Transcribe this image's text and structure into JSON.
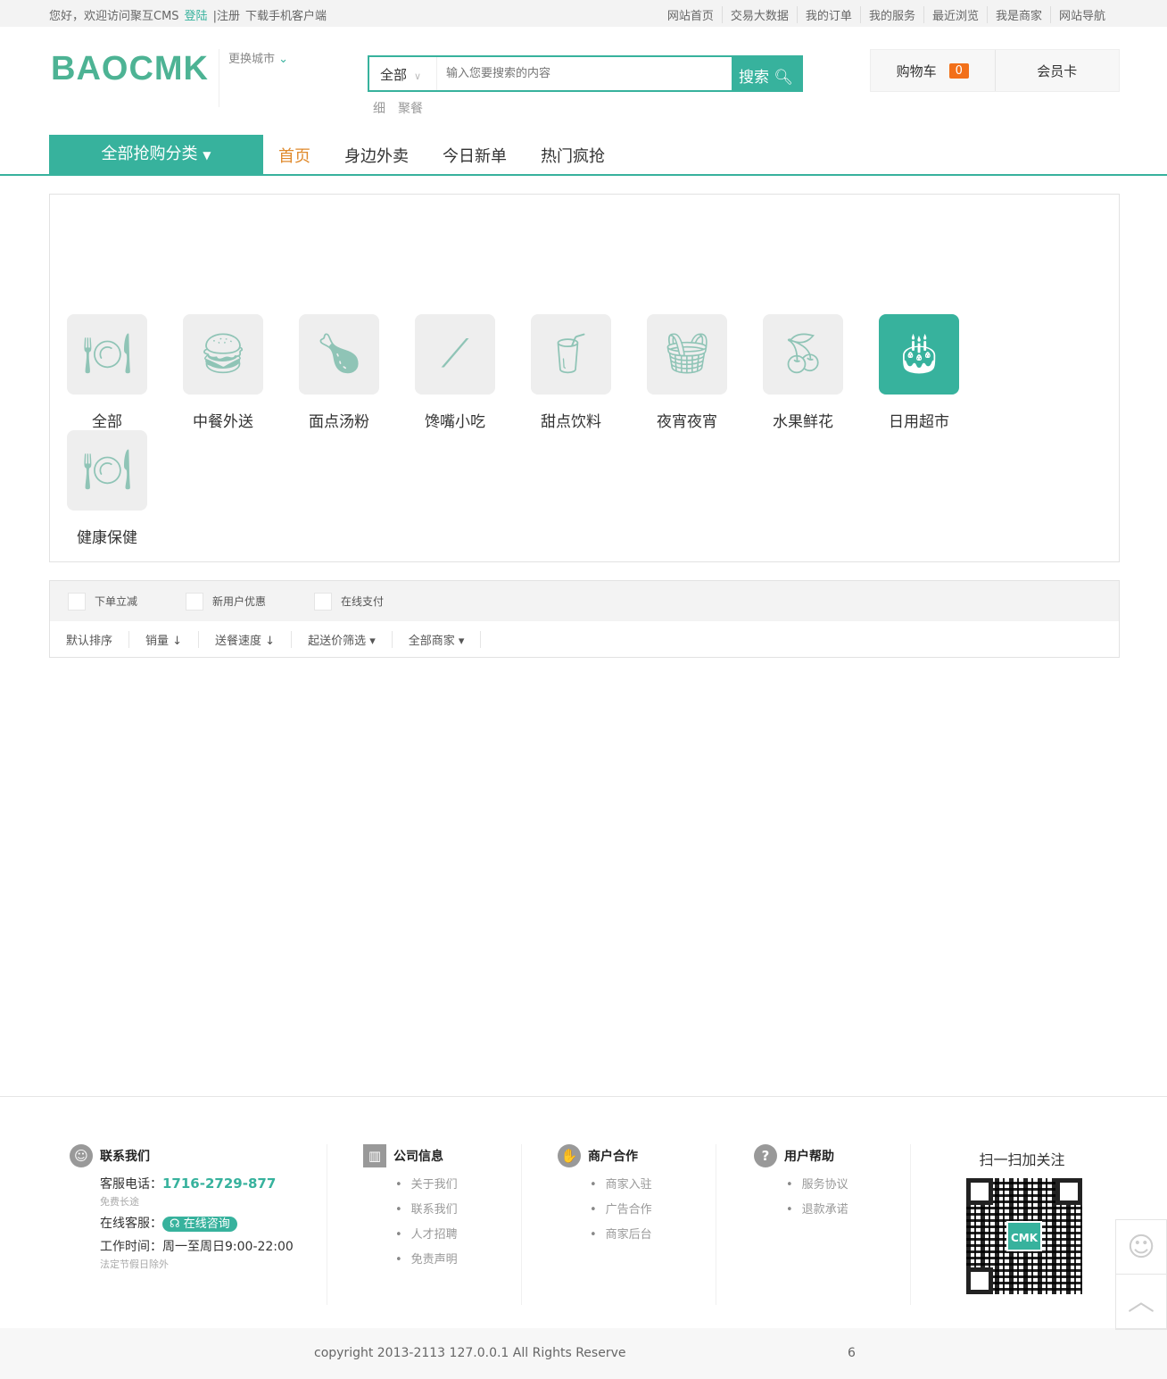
{
  "topbar": {
    "welcome": "您好，欢迎访问聚互CMS",
    "login": "登陆",
    "register": "注册",
    "download": "下载手机客户端",
    "links": [
      "网站首页",
      "交易大数据",
      "我的订单",
      "我的服务",
      "最近浏览",
      "我是商家",
      "网站导航"
    ]
  },
  "header": {
    "logo": "BAOCMK",
    "city": "更换城市",
    "search_scope": "全部",
    "search_placeholder": "输入您要搜索的内容",
    "search_button": "搜索",
    "hot_words": [
      "细",
      "聚餐"
    ],
    "cart": "购物车",
    "cart_count": "0",
    "member_card": "会员卡"
  },
  "nav": {
    "all_categories": "全部抢购分类",
    "items": [
      "首页",
      "身边外卖",
      "今日新单",
      "热门疯抢"
    ]
  },
  "categories": [
    {
      "label": "全部",
      "icon": "plate-icon"
    },
    {
      "label": "中餐外送",
      "icon": "burger-drink-icon"
    },
    {
      "label": "面点汤粉",
      "icon": "chicken-icon"
    },
    {
      "label": "馋嘴小吃",
      "icon": "skewer-icon"
    },
    {
      "label": "甜点饮料",
      "icon": "juice-icon"
    },
    {
      "label": "夜宵夜宵",
      "icon": "basket-icon"
    },
    {
      "label": "水果鲜花",
      "icon": "cherry-icon"
    },
    {
      "label": "日用超市",
      "icon": "cake-icon"
    },
    {
      "label": "健康保健",
      "icon": "plate-icon"
    }
  ],
  "filters": {
    "checks": [
      "下单立减",
      "新用户优惠",
      "在线支付"
    ],
    "sorts": [
      "默认排序",
      "销量 ↓",
      "送餐速度 ↓",
      "起送价筛选 ▾",
      "全部商家 ▾"
    ]
  },
  "footer": {
    "contact": {
      "title": "联系我们",
      "phone_label": "客服电话：",
      "phone": "1716-2729-877",
      "free": "免费长途",
      "online_label": "在线客服：",
      "online_btn": "在线咨询",
      "hours": "工作时间：周一至周日9:00-22:00",
      "holiday": "法定节假日除外"
    },
    "company": {
      "title": "公司信息",
      "links": [
        "关于我们",
        "联系我们",
        "人才招聘",
        "免责声明"
      ]
    },
    "merchant": {
      "title": "商户合作",
      "links": [
        "商家入驻",
        "广告合作",
        "商家后台"
      ]
    },
    "help": {
      "title": "用户帮助",
      "links": [
        "服务协议",
        "退款承诺"
      ]
    },
    "follow": "扫一扫加关注",
    "qr_text": "CMK",
    "copyright": "copyright 2013-2113 127.0.0.1 All Rights Reserve",
    "page_num": "6"
  },
  "colors": {
    "accent": "#37b29d",
    "badge": "#f27019",
    "active_nav": "#e08a2c"
  }
}
